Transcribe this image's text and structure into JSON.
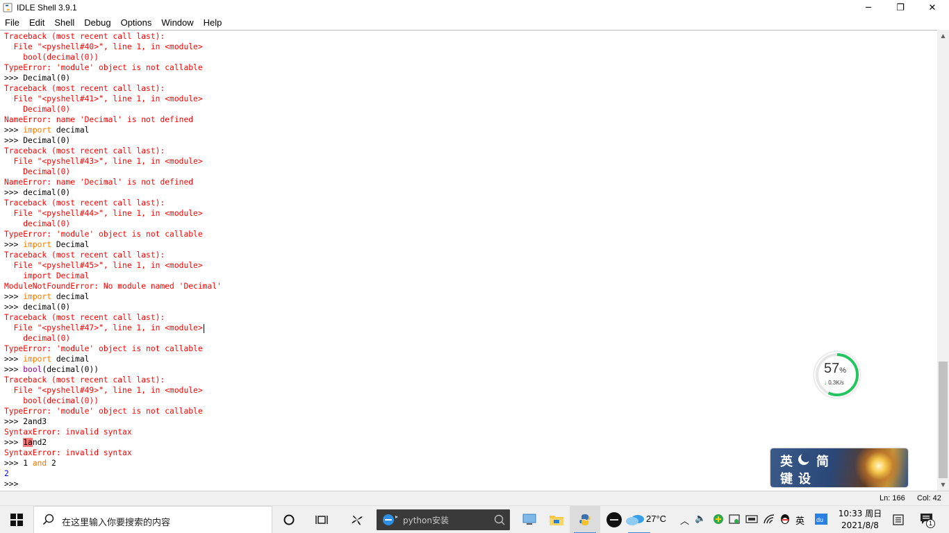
{
  "window": {
    "title": "IDLE Shell 3.9.1",
    "minimize_glyph": "─",
    "maximize_glyph": "❐",
    "close_glyph": "✕"
  },
  "menu": [
    "File",
    "Edit",
    "Shell",
    "Debug",
    "Options",
    "Window",
    "Help"
  ],
  "shell_lines": [
    [
      {
        "t": "Traceback (most recent call last):",
        "c": "err"
      }
    ],
    [
      {
        "t": "  File \"<pyshell#40>\", line 1, in <module>",
        "c": "err"
      }
    ],
    [
      {
        "t": "    bool(decimal(0))",
        "c": "err"
      }
    ],
    [
      {
        "t": "TypeError: 'module' object is not callable",
        "c": "err"
      }
    ],
    [
      {
        "t": ">>> ",
        "c": ""
      },
      {
        "t": "Decimal(0)",
        "c": ""
      }
    ],
    [
      {
        "t": "Traceback (most recent call last):",
        "c": "err"
      }
    ],
    [
      {
        "t": "  File \"<pyshell#41>\", line 1, in <module>",
        "c": "err"
      }
    ],
    [
      {
        "t": "    Decimal(0)",
        "c": "err"
      }
    ],
    [
      {
        "t": "NameError: name 'Decimal' is not defined",
        "c": "err"
      }
    ],
    [
      {
        "t": ">>> ",
        "c": ""
      },
      {
        "t": "import",
        "c": "kw"
      },
      {
        "t": " decimal",
        "c": ""
      }
    ],
    [
      {
        "t": ">>> ",
        "c": ""
      },
      {
        "t": "Decimal(0)",
        "c": ""
      }
    ],
    [
      {
        "t": "Traceback (most recent call last):",
        "c": "err"
      }
    ],
    [
      {
        "t": "  File \"<pyshell#43>\", line 1, in <module>",
        "c": "err"
      }
    ],
    [
      {
        "t": "    Decimal(0)",
        "c": "err"
      }
    ],
    [
      {
        "t": "NameError: name 'Decimal' is not defined",
        "c": "err"
      }
    ],
    [
      {
        "t": ">>> ",
        "c": ""
      },
      {
        "t": "decimal(0)",
        "c": ""
      }
    ],
    [
      {
        "t": "Traceback (most recent call last):",
        "c": "err"
      }
    ],
    [
      {
        "t": "  File \"<pyshell#44>\", line 1, in <module>",
        "c": "err"
      }
    ],
    [
      {
        "t": "    decimal(0)",
        "c": "err"
      }
    ],
    [
      {
        "t": "TypeError: 'module' object is not callable",
        "c": "err"
      }
    ],
    [
      {
        "t": ">>> ",
        "c": ""
      },
      {
        "t": "import",
        "c": "kw"
      },
      {
        "t": " Decimal",
        "c": ""
      }
    ],
    [
      {
        "t": "Traceback (most recent call last):",
        "c": "err"
      }
    ],
    [
      {
        "t": "  File \"<pyshell#45>\", line 1, in <module>",
        "c": "err"
      }
    ],
    [
      {
        "t": "    import Decimal",
        "c": "err"
      }
    ],
    [
      {
        "t": "ModuleNotFoundError: No module named 'Decimal'",
        "c": "err"
      }
    ],
    [
      {
        "t": ">>> ",
        "c": ""
      },
      {
        "t": "import",
        "c": "kw"
      },
      {
        "t": " decimal",
        "c": ""
      }
    ],
    [
      {
        "t": ">>> ",
        "c": ""
      },
      {
        "t": "decimal(0)",
        "c": ""
      }
    ],
    [
      {
        "t": "Traceback (most recent call last):",
        "c": "err"
      }
    ],
    [
      {
        "t": "  File \"<pyshell#47>\", line 1, in <module>",
        "c": "err"
      },
      {
        "t": "",
        "c": "cursor"
      }
    ],
    [
      {
        "t": "    decimal(0)",
        "c": "err"
      }
    ],
    [
      {
        "t": "TypeError: 'module' object is not callable",
        "c": "err"
      }
    ],
    [
      {
        "t": ">>> ",
        "c": ""
      },
      {
        "t": "import",
        "c": "kw"
      },
      {
        "t": " decimal",
        "c": ""
      }
    ],
    [
      {
        "t": ">>> ",
        "c": ""
      },
      {
        "t": "bool",
        "c": "bi"
      },
      {
        "t": "(decimal(0))",
        "c": ""
      }
    ],
    [
      {
        "t": "Traceback (most recent call last):",
        "c": "err"
      }
    ],
    [
      {
        "t": "  File \"<pyshell#49>\", line 1, in <module>",
        "c": "err"
      }
    ],
    [
      {
        "t": "    bool(decimal(0))",
        "c": "err"
      }
    ],
    [
      {
        "t": "TypeError: 'module' object is not callable",
        "c": "err"
      }
    ],
    [
      {
        "t": ">>> ",
        "c": ""
      },
      {
        "t": "2and3",
        "c": ""
      }
    ],
    [
      {
        "t": "SyntaxError: invalid syntax",
        "c": "err"
      }
    ],
    [
      {
        "t": ">>> ",
        "c": ""
      },
      {
        "t": "1a",
        "c": "hl"
      },
      {
        "t": "nd2",
        "c": ""
      }
    ],
    [
      {
        "t": "SyntaxError: invalid syntax",
        "c": "err"
      }
    ],
    [
      {
        "t": ">>> ",
        "c": ""
      },
      {
        "t": "1 ",
        "c": ""
      },
      {
        "t": "and",
        "c": "kw"
      },
      {
        "t": " 2",
        "c": ""
      }
    ],
    [
      {
        "t": "2",
        "c": "out"
      }
    ],
    [
      {
        "t": ">>> ",
        "c": ""
      }
    ]
  ],
  "status": {
    "ln": "Ln: 166",
    "col": "Col: 42"
  },
  "net_widget": {
    "percent": "57",
    "percent_symbol": "%",
    "arrow": "↓",
    "speed": "0.3K/s",
    "level": 0.57,
    "color": "#22c55e"
  },
  "ime_widget": {
    "char1": "英",
    "char2": "简",
    "char3": "键",
    "char4": "设"
  },
  "taskbar": {
    "search_placeholder": "在这里输入你要搜索的内容",
    "ie_text": "python安装",
    "temperature": "27°C",
    "tray_ime": "英",
    "time": "10:33 周日",
    "date": "2021/8/8",
    "notification_count": "1",
    "accent": "#3a86d9"
  }
}
